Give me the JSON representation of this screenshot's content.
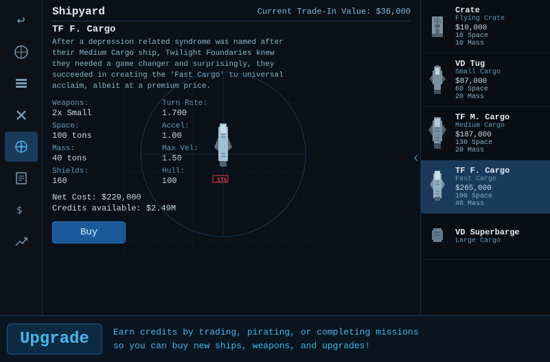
{
  "header": {
    "title": "Shipyard",
    "trade_value_label": "Current Trade-In Value: $36,000"
  },
  "ship": {
    "name": "TF F. Cargo",
    "description": "After a depression related syndrome was named after their Medium Cargo ship, Twilight Foundaries knew they needed a game changer and surprisingly, they succeeded in creating the 'Fast Cargo' to universal acclaim, albeit at a premium price.",
    "stats": {
      "weapons_label": "Weapons:",
      "weapons_value": "2x Small",
      "turn_rate_label": "Turn Rate:",
      "turn_rate_value": "1.700",
      "space_label": "Space:",
      "space_value": "100 tons",
      "accel_label": "Accel:",
      "accel_value": "1.00",
      "mass_label": "Mass:",
      "mass_value": "40 tons",
      "max_vel_label": "Max Vel:",
      "max_vel_value": "1.50",
      "shields_label": "Shields:",
      "shields_value": "160",
      "hull_label": "Hull:",
      "hull_value": "100"
    },
    "net_cost": "Net Cost: $229,000",
    "credits": "Credits available: $2.49M",
    "buy_label": "Buy"
  },
  "ship_list": [
    {
      "name": "Crate",
      "type": "Flying Crate",
      "price": "$10,000",
      "space": "10 Space",
      "mass": "10 Mass",
      "selected": false
    },
    {
      "name": "VD Tug",
      "type": "Small Cargo",
      "price": "$87,000",
      "space": "60 Space",
      "mass": "20 Mass",
      "selected": false
    },
    {
      "name": "TF M. Cargo",
      "type": "Medium Cargo",
      "price": "$187,000",
      "space": "130 Space",
      "mass": "20 Mass",
      "selected": false
    },
    {
      "name": "TF F. Cargo",
      "type": "Fast Cargo",
      "price": "$265,000",
      "space": "100 Space",
      "mass": "40 Mass",
      "selected": true
    },
    {
      "name": "VD Superbarge",
      "type": "Large Cargo",
      "price": "",
      "space": "",
      "mass": "",
      "selected": false
    }
  ],
  "sidebar": {
    "icons": [
      {
        "name": "back-icon",
        "symbol": "↩",
        "active": false
      },
      {
        "name": "map-icon",
        "symbol": "◎",
        "active": false
      },
      {
        "name": "inventory-icon",
        "symbol": "≡",
        "active": false
      },
      {
        "name": "tools-icon",
        "symbol": "✕",
        "active": false
      },
      {
        "name": "ship-icon",
        "symbol": "⛵",
        "active": true
      },
      {
        "name": "missions-icon",
        "symbol": "📋",
        "active": false
      },
      {
        "name": "trade-icon",
        "symbol": "$",
        "active": false
      },
      {
        "name": "stats-icon",
        "symbol": "↗",
        "active": false
      }
    ]
  },
  "upgrade_bar": {
    "label": "Upgrade",
    "text": "Earn credits by trading, pirating, or completing missions\nso you can buy new ships, weapons, and upgrades!"
  },
  "colors": {
    "accent": "#4ab4e8",
    "selected_bg": "#1a3a5c",
    "dark_bg": "#0a0e14"
  }
}
